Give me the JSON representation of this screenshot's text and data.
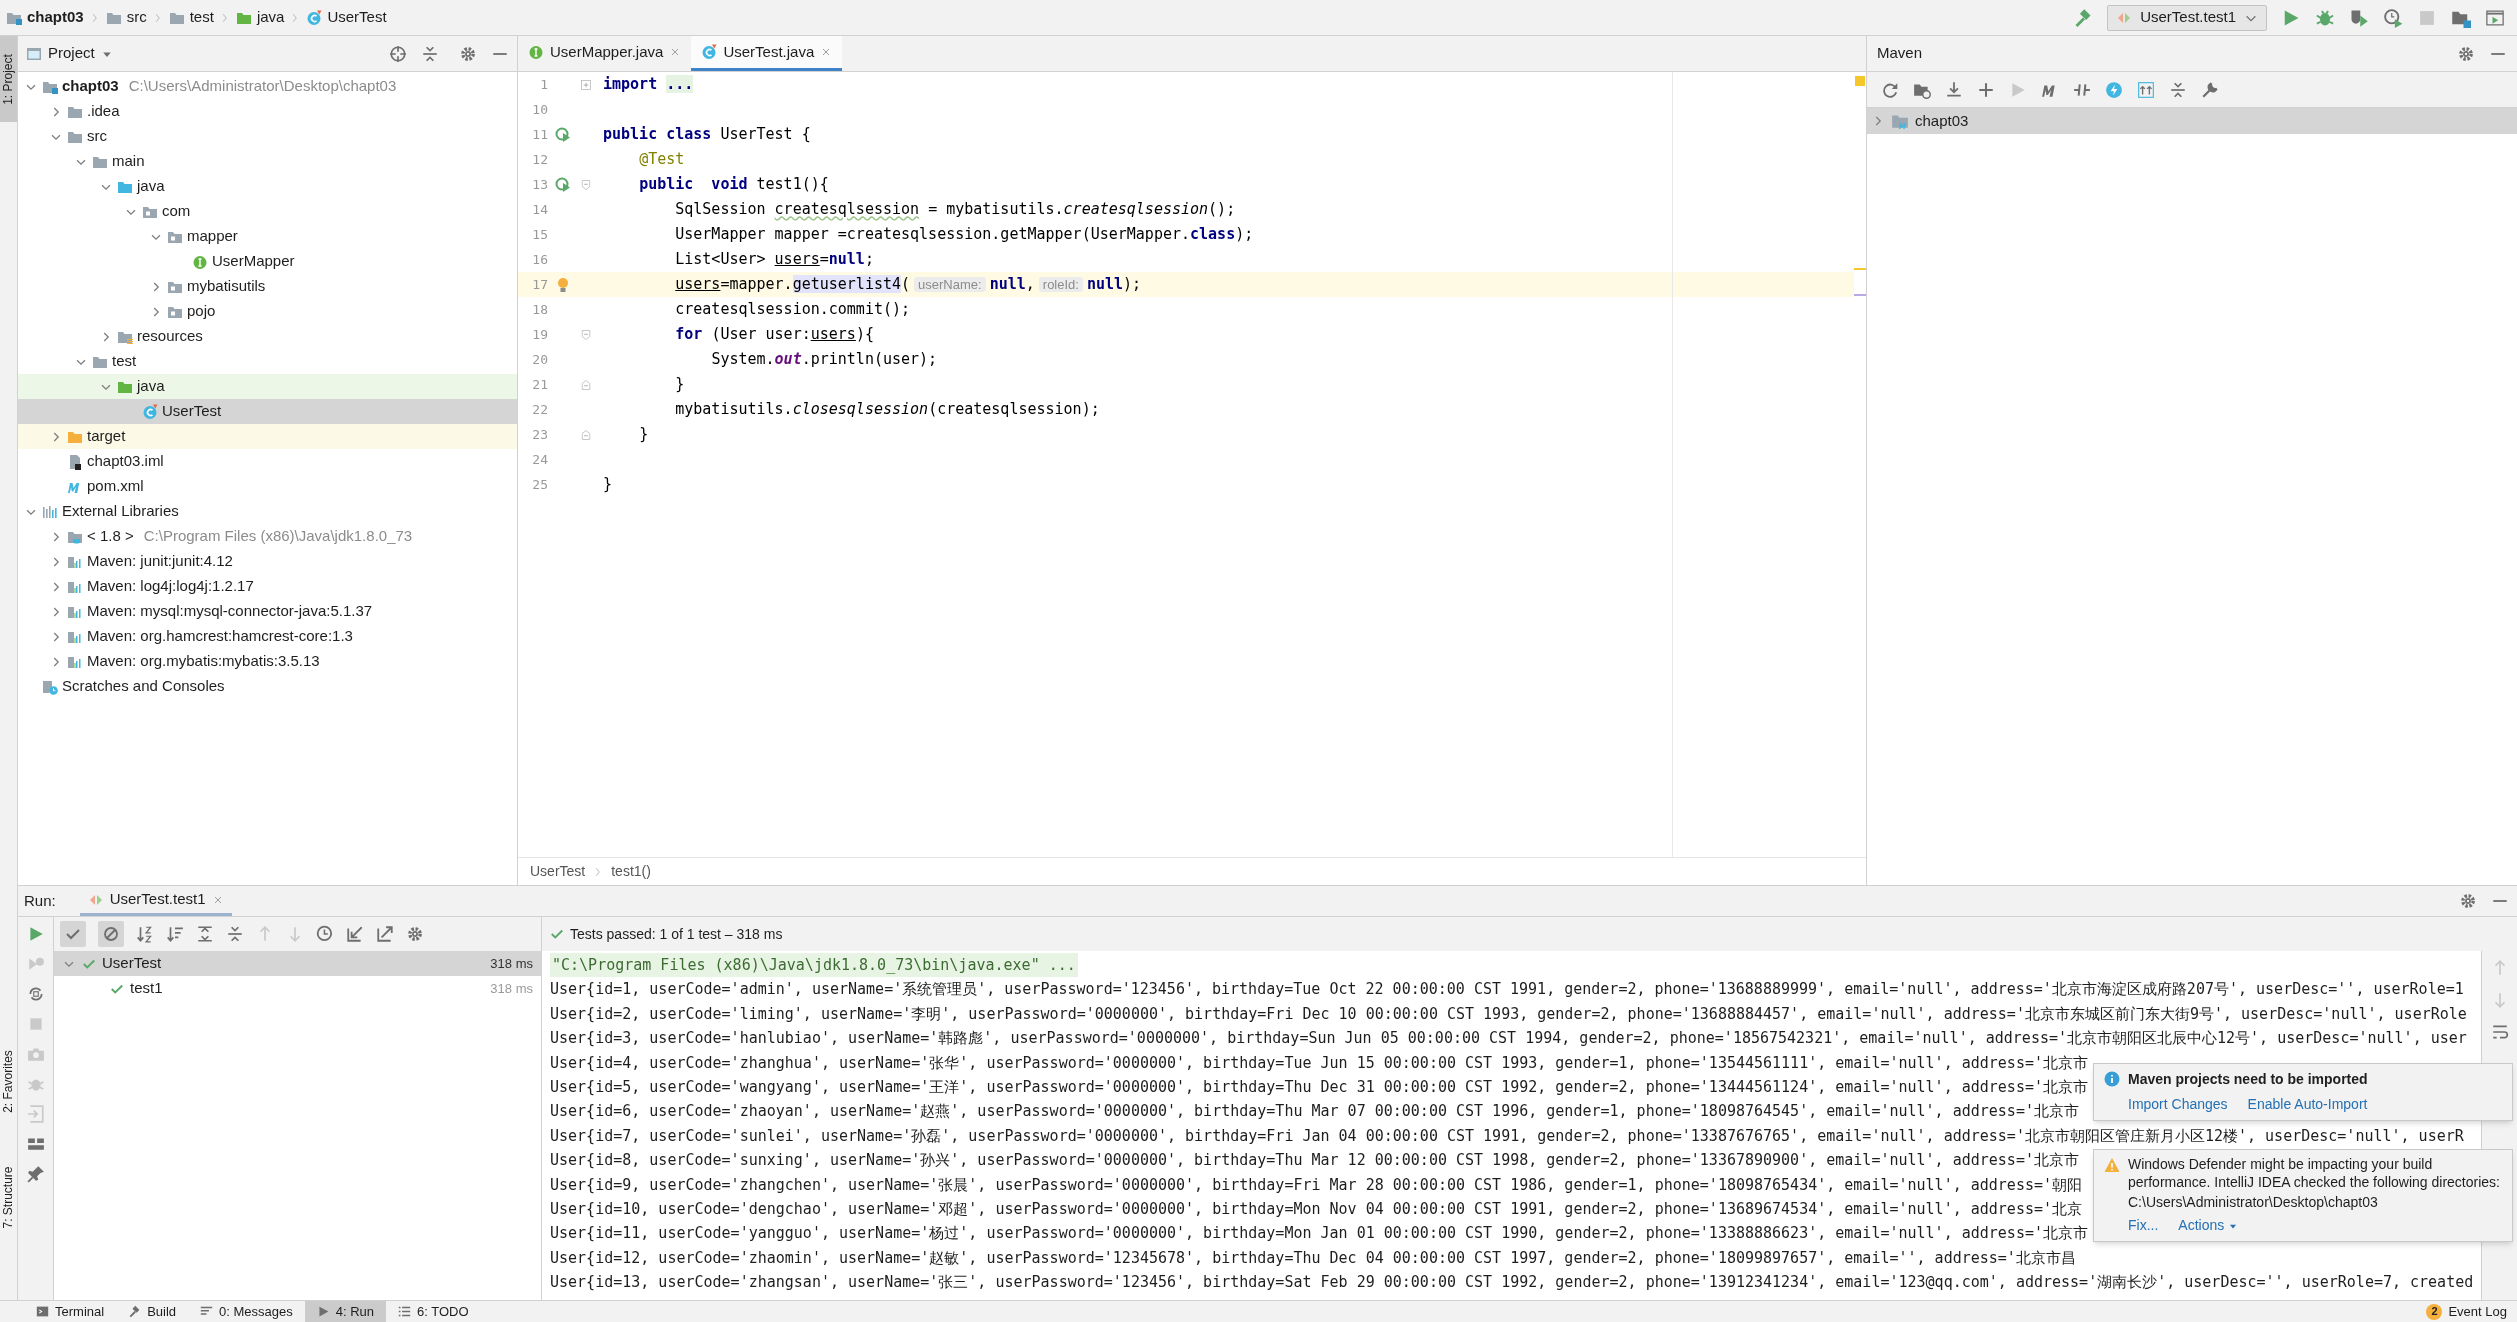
{
  "breadcrumbs": [
    {
      "label": "chapt03",
      "kind": "module"
    },
    {
      "label": "src",
      "kind": "folder"
    },
    {
      "label": "test",
      "kind": "folder"
    },
    {
      "label": "java",
      "kind": "test-root"
    },
    {
      "label": "UserTest",
      "kind": "test-class"
    }
  ],
  "run_config": "UserTest.test1",
  "tool_windows": {
    "top": [
      {
        "label": "1: Project",
        "selected": true
      }
    ],
    "bottom": [
      {
        "label": "2: Favorites",
        "selected": false
      },
      {
        "label": "7: Structure",
        "selected": false
      }
    ]
  },
  "project": {
    "title": "Project",
    "tree": [
      {
        "label": "chapt03",
        "path": "C:\\Users\\Administrator\\Desktop\\chapt03",
        "kind": "module",
        "expanded": true,
        "selected": false,
        "children": [
          {
            "label": ".idea",
            "kind": "folder",
            "expanded": false,
            "selected": false
          },
          {
            "label": "src",
            "kind": "folder",
            "expanded": true,
            "selected": false,
            "children": [
              {
                "label": "main",
                "kind": "folder",
                "expanded": true,
                "selected": false,
                "children": [
                  {
                    "label": "java",
                    "kind": "src-root",
                    "expanded": true,
                    "selected": false,
                    "children": [
                      {
                        "label": "com",
                        "kind": "package",
                        "expanded": true,
                        "selected": false,
                        "children": [
                          {
                            "label": "mapper",
                            "kind": "package",
                            "expanded": true,
                            "selected": false,
                            "children": [
                              {
                                "label": "UserMapper",
                                "kind": "interface",
                                "selected": false
                              }
                            ]
                          },
                          {
                            "label": "mybatisutils",
                            "kind": "package",
                            "expanded": false,
                            "selected": false
                          },
                          {
                            "label": "pojo",
                            "kind": "package",
                            "expanded": false,
                            "selected": false
                          }
                        ]
                      }
                    ]
                  },
                  {
                    "label": "resources",
                    "kind": "resources",
                    "expanded": false,
                    "selected": false
                  }
                ]
              },
              {
                "label": "test",
                "kind": "folder",
                "expanded": true,
                "selected": false,
                "children": [
                  {
                    "label": "java",
                    "kind": "test-root",
                    "expanded": true,
                    "selected": false,
                    "children": [
                      {
                        "label": "UserTest",
                        "kind": "test-class",
                        "selected": true
                      }
                    ]
                  }
                ]
              }
            ]
          },
          {
            "label": "target",
            "kind": "excluded",
            "expanded": false,
            "selected": false
          },
          {
            "label": "chapt03.iml",
            "kind": "iml",
            "selected": false
          },
          {
            "label": "pom.xml",
            "kind": "maven",
            "selected": false
          }
        ]
      },
      {
        "label": "External Libraries",
        "kind": "libraries",
        "expanded": true,
        "selected": false,
        "children": [
          {
            "label": "< 1.8 >",
            "path": "C:\\Program Files (x86)\\Java\\jdk1.8.0_73",
            "kind": "jdk",
            "expanded": false,
            "selected": false
          },
          {
            "label": "Maven: junit:junit:4.12",
            "kind": "library",
            "expanded": false,
            "selected": false
          },
          {
            "label": "Maven: log4j:log4j:1.2.17",
            "kind": "library",
            "expanded": false,
            "selected": false
          },
          {
            "label": "Maven: mysql:mysql-connector-java:5.1.37",
            "kind": "library",
            "expanded": false,
            "selected": false
          },
          {
            "label": "Maven: org.hamcrest:hamcrest-core:1.3",
            "kind": "library",
            "expanded": false,
            "selected": false
          },
          {
            "label": "Maven: org.mybatis:mybatis:3.5.13",
            "kind": "library",
            "expanded": false,
            "selected": false
          }
        ]
      },
      {
        "label": "Scratches and Consoles",
        "kind": "scratches",
        "selected": false
      }
    ]
  },
  "editor": {
    "tabs": [
      {
        "label": "UserMapper.java",
        "kind": "interface",
        "selected": false
      },
      {
        "label": "UserTest.java",
        "kind": "test-class",
        "selected": true
      }
    ],
    "lines": [
      {
        "number": "1",
        "fold": {
          "kind": "collapsed"
        },
        "tokens": [
          {
            "text": "import ",
            "kind": "kw"
          },
          {
            "text": "...",
            "kind": "folded"
          }
        ]
      },
      {
        "number": "10"
      },
      {
        "number": "11",
        "gutter": {
          "kind": "run"
        },
        "tokens": [
          {
            "text": "public class",
            "kind": "kw"
          },
          {
            "text": " UserTest {",
            "kind": "plain"
          }
        ]
      },
      {
        "number": "12",
        "tokens": [
          {
            "text": "    @Test",
            "kind": "annotation"
          }
        ]
      },
      {
        "number": "13",
        "gutter": {
          "kind": "run"
        },
        "fold": {
          "kind": "open"
        },
        "tokens": [
          {
            "text": "    public  void",
            "kind": "kw"
          },
          {
            "text": " test1(){",
            "kind": "plain"
          }
        ]
      },
      {
        "number": "14",
        "tokens": [
          {
            "text": "        SqlSession ",
            "kind": "plain"
          },
          {
            "text": "createsqlsession",
            "kind": "warn"
          },
          {
            "text": " = mybatisutils.",
            "kind": "plain"
          },
          {
            "text": "createsqlsession",
            "kind": "static"
          },
          {
            "text": "();",
            "kind": "plain"
          }
        ]
      },
      {
        "number": "15",
        "tokens": [
          {
            "text": "        UserMapper mapper =createsqlsession.getMapper(UserMapper.",
            "kind": "plain"
          },
          {
            "text": "class",
            "kind": "kw"
          },
          {
            "text": ");",
            "kind": "plain"
          }
        ]
      },
      {
        "number": "16",
        "tokens": [
          {
            "text": "        List<User> ",
            "kind": "plain"
          },
          {
            "text": "users",
            "kind": "underline"
          },
          {
            "text": "=",
            "kind": "plain"
          },
          {
            "text": "null",
            "kind": "kw"
          },
          {
            "text": ";",
            "kind": "plain"
          }
        ]
      },
      {
        "number": "17",
        "gutter": {
          "kind": "bulb"
        },
        "current": true,
        "tokens": [
          {
            "text": "        users",
            "kind": "underline"
          },
          {
            "text": "=mapper.",
            "kind": "plain"
          },
          {
            "text": "getuserlist4",
            "kind": "ref"
          },
          {
            "text": "(",
            "kind": "plain"
          },
          {
            "text": "userName:",
            "kind": "hint"
          },
          {
            "text": "null",
            "kind": "kw"
          },
          {
            "text": ",",
            "kind": "plain"
          },
          {
            "text": "roleId:",
            "kind": "hint"
          },
          {
            "text": "null",
            "kind": "kw"
          },
          {
            "text": ");",
            "kind": "plain"
          }
        ]
      },
      {
        "number": "18",
        "tokens": [
          {
            "text": "        createsqlsession.commit();",
            "kind": "plain"
          }
        ]
      },
      {
        "number": "19",
        "fold": {
          "kind": "open"
        },
        "tokens": [
          {
            "text": "        for",
            "kind": "kw"
          },
          {
            "text": " (User user:",
            "kind": "plain"
          },
          {
            "text": "users",
            "kind": "underline"
          },
          {
            "text": "){",
            "kind": "plain"
          }
        ]
      },
      {
        "number": "20",
        "tokens": [
          {
            "text": "            System.",
            "kind": "plain"
          },
          {
            "text": "out",
            "kind": "field"
          },
          {
            "text": ".println(user);",
            "kind": "plain"
          }
        ]
      },
      {
        "number": "21",
        "fold": {
          "kind": "close"
        },
        "tokens": [
          {
            "text": "        }",
            "kind": "plain"
          }
        ]
      },
      {
        "number": "22",
        "tokens": [
          {
            "text": "        mybatisutils.",
            "kind": "plain"
          },
          {
            "text": "closesqlsession",
            "kind": "static"
          },
          {
            "text": "(createsqlsession);",
            "kind": "plain"
          }
        ]
      },
      {
        "number": "23",
        "fold": {
          "kind": "close"
        },
        "tokens": [
          {
            "text": "    }",
            "kind": "plain"
          }
        ]
      },
      {
        "number": "24"
      },
      {
        "number": "25",
        "tokens": [
          {
            "text": "}",
            "kind": "plain"
          }
        ]
      }
    ],
    "breadcrumbs": [
      "UserTest",
      "test1()"
    ]
  },
  "maven": {
    "title": "Maven",
    "tree": [
      {
        "label": "chapt03",
        "expanded": false,
        "selected": true
      }
    ]
  },
  "run": {
    "title": "Run:",
    "tab": "UserTest.test1",
    "status": "Tests passed: 1 of 1 test – 318 ms",
    "tests": [
      {
        "label": "UserTest",
        "time": "318 ms",
        "expanded": true,
        "selected": true,
        "children": [
          {
            "label": "test1",
            "time": "318 ms",
            "selected": false
          }
        ]
      }
    ],
    "command": "\"C:\\Program Files (x86)\\Java\\jdk1.8.0_73\\bin\\java.exe\" ...",
    "output": [
      "User{id=1, userCode='admin', userName='系统管理员', userPassword='123456', birthday=Tue Oct 22 00:00:00 CST 1991, gender=2, phone='13688889999', email='null', address='北京市海淀区成府路207号', userDesc='', userRole=1",
      "User{id=2, userCode='liming', userName='李明', userPassword='0000000', birthday=Fri Dec 10 00:00:00 CST 1993, gender=2, phone='13688884457', email='null', address='北京市东城区前门东大街9号', userDesc='null', userRole",
      "User{id=3, userCode='hanlubiao', userName='韩路彪', userPassword='0000000', birthday=Sun Jun 05 00:00:00 CST 1994, gender=2, phone='18567542321', email='null', address='北京市朝阳区北辰中心12号', userDesc='null', user",
      "User{id=4, userCode='zhanghua', userName='张华', userPassword='0000000', birthday=Tue Jun 15 00:00:00 CST 1993, gender=1, phone='13544561111', email='null', address='北京市",
      "User{id=5, userCode='wangyang', userName='王洋', userPassword='0000000', birthday=Thu Dec 31 00:00:00 CST 1992, gender=2, phone='13444561124', email='null', address='北京市",
      "User{id=6, userCode='zhaoyan', userName='赵燕', userPassword='0000000', birthday=Thu Mar 07 00:00:00 CST 1996, gender=1, phone='18098764545', email='null', address='北京市",
      "User{id=7, userCode='sunlei', userName='孙磊', userPassword='0000000', birthday=Fri Jan 04 00:00:00 CST 1991, gender=2, phone='13387676765', email='null', address='北京市朝阳区管庄新月小区12楼', userDesc='null', userR",
      "User{id=8, userCode='sunxing', userName='孙兴', userPassword='0000000', birthday=Thu Mar 12 00:00:00 CST 1998, gender=2, phone='13367890900', email='null', address='北京市",
      "User{id=9, userCode='zhangchen', userName='张晨', userPassword='0000000', birthday=Fri Mar 28 00:00:00 CST 1986, gender=1, phone='18098765434', email='null', address='朝阳",
      "User{id=10, userCode='dengchao', userName='邓超', userPassword='0000000', birthday=Mon Nov 04 00:00:00 CST 1991, gender=2, phone='13689674534', email='null', address='北京",
      "User{id=11, userCode='yangguo', userName='杨过', userPassword='0000000', birthday=Mon Jan 01 00:00:00 CST 1990, gender=2, phone='13388886623', email='null', address='北京市",
      "User{id=12, userCode='zhaomin', userName='赵敏', userPassword='12345678', birthday=Thu Dec 04 00:00:00 CST 1997, gender=2, phone='18099897657', email='', address='北京市昌",
      "User{id=13, userCode='zhangsan', userName='张三', userPassword='123456', birthday=Sat Feb 29 00:00:00 CST 1992, gender=2, phone='13912341234', email='123@qq.com', address='湖南长沙', userDesc='', userRole=7, created"
    ],
    "notifications": [
      {
        "kind": "info",
        "title": "Maven projects need to be imported",
        "links": [
          {
            "label": "Import Changes",
            "dropdown": false
          },
          {
            "label": "Enable Auto-Import",
            "dropdown": false
          }
        ]
      },
      {
        "kind": "warning",
        "message": "Windows Defender might be impacting your build performance. IntelliJ IDEA checked the following directories:",
        "path": "C:\\Users\\Administrator\\Desktop\\chapt03",
        "links": [
          {
            "label": "Fix...",
            "dropdown": false
          },
          {
            "label": "Actions",
            "dropdown": true
          }
        ]
      }
    ]
  },
  "bottom_bar": {
    "tabs": [
      {
        "label": "Terminal",
        "kind": "terminal",
        "selected": false
      },
      {
        "label": "Build",
        "kind": "build",
        "selected": false
      },
      {
        "label": "0: Messages",
        "kind": "messages",
        "selected": false
      },
      {
        "label": "4: Run",
        "kind": "run",
        "selected": true
      },
      {
        "label": "6: TODO",
        "kind": "todo",
        "selected": false
      }
    ],
    "event_log": {
      "label": "Event Log",
      "count": "2"
    }
  }
}
